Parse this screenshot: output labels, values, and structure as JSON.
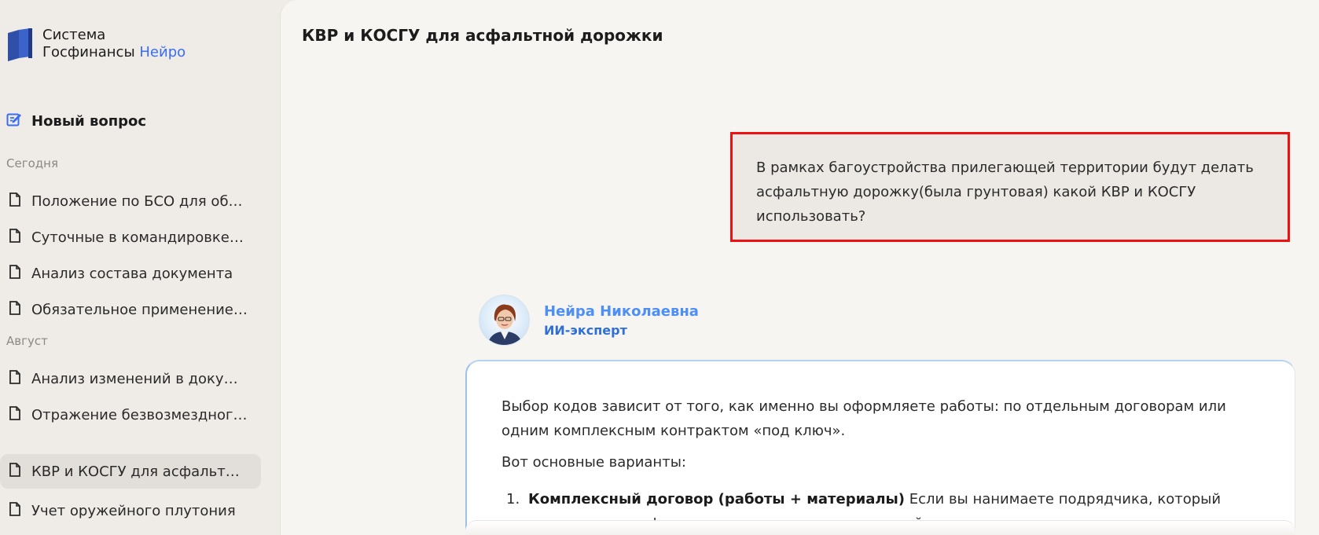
{
  "sidebar": {
    "logo_line1": "Система",
    "logo_line2": "Госфинансы",
    "logo_accent": "Нейро",
    "new_question": "Новый вопрос",
    "groups": [
      {
        "label": "Сегодня",
        "items": [
          {
            "label": "Положение по БСО для обр..."
          },
          {
            "label": "Суточные в командировке Т..."
          },
          {
            "label": "Анализ состава документа"
          },
          {
            "label": "Обязательное применение ..."
          }
        ]
      },
      {
        "label": "Август",
        "items": [
          {
            "label": "Анализ изменений в докуме..."
          },
          {
            "label": "Отражение безвозмездного..."
          },
          {
            "label": "КВР и КОСГУ для асфальтно..."
          },
          {
            "label": "Учет оружейного плутония"
          }
        ]
      }
    ]
  },
  "main": {
    "title": "КВР и КОСГУ для асфальтной дорожки",
    "user_message": "В рамках багоустройства прилегающей территории будут делать асфальтную дорожку(была грунтовая) какой КВР и КОСГУ использовать?",
    "bot": {
      "name": "Нейра Николаевна",
      "role": "ИИ-эксперт",
      "paragraph1": "Выбор кодов зависит от того, как именно вы оформляете работы: по отдельным договорам или одним комплексным контрактом «под ключ».",
      "paragraph2": "Вот основные варианты:",
      "list": [
        {
          "num": "1.",
          "bold": "Комплексный договор (работы + материалы)",
          "text": " Если вы нанимаете подрядчика, который сам закупает асфальт и делает дорожку, используйте:"
        }
      ]
    }
  },
  "colors": {
    "accent_blue": "#3a6df0",
    "bot_name": "#4d8ff5",
    "highlight_border": "#ee1111"
  }
}
